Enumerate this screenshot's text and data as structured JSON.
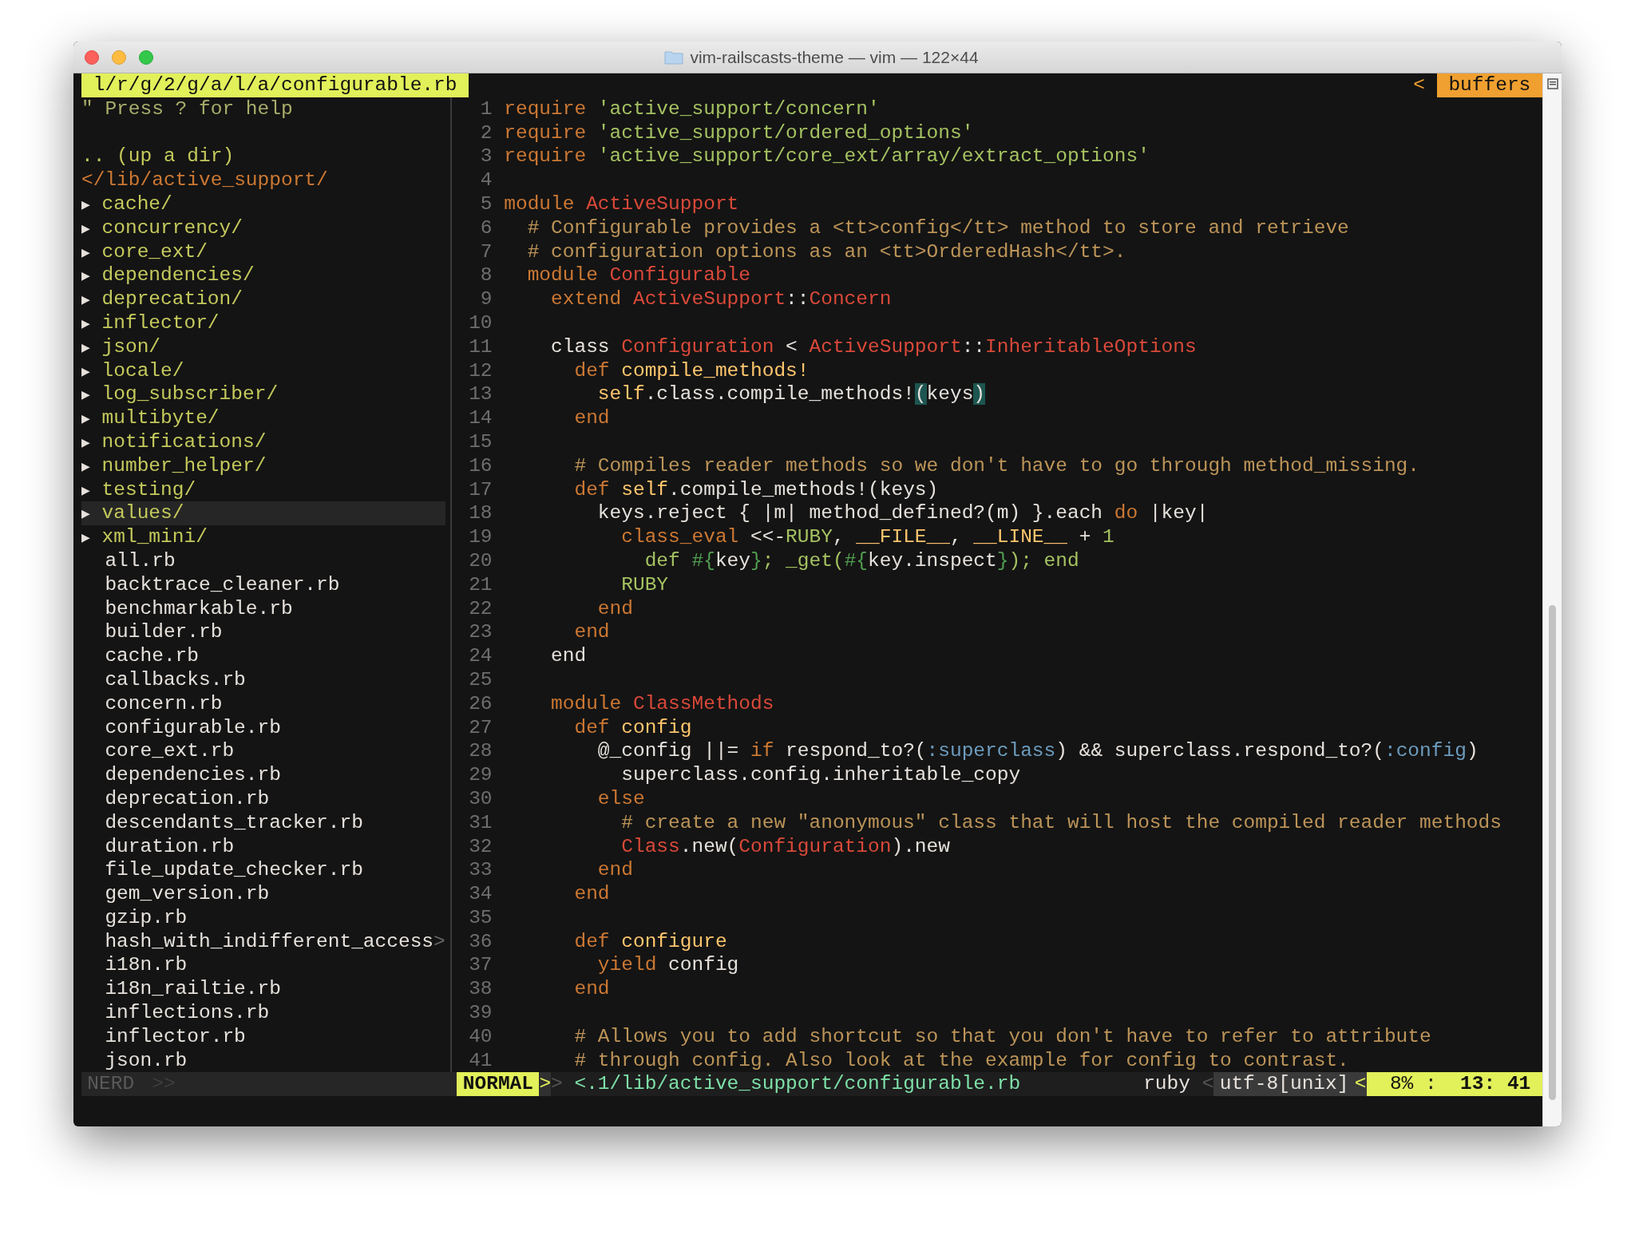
{
  "window": {
    "title": "vim-railscasts-theme — vim — 122×44"
  },
  "tabline": {
    "path": "l/r/g/2/g/a/l/a/configurable.rb",
    "separator": "<",
    "buffers": "buffers"
  },
  "tree": {
    "help": "\" Press ? for help",
    "up_dir": ".. (up a dir)",
    "root": "</lib/active_support/",
    "items": [
      {
        "kind": "dir",
        "arrow": "▶",
        "name": "cache/",
        "selected": false
      },
      {
        "kind": "dir",
        "arrow": "▶",
        "name": "concurrency/",
        "selected": false
      },
      {
        "kind": "dir",
        "arrow": "▶",
        "name": "core_ext/",
        "selected": false
      },
      {
        "kind": "dir",
        "arrow": "▶",
        "name": "dependencies/",
        "selected": false
      },
      {
        "kind": "dir",
        "arrow": "▶",
        "name": "deprecation/",
        "selected": false
      },
      {
        "kind": "dir",
        "arrow": "▶",
        "name": "inflector/",
        "selected": false
      },
      {
        "kind": "dir",
        "arrow": "▶",
        "name": "json/",
        "selected": false
      },
      {
        "kind": "dir",
        "arrow": "▶",
        "name": "locale/",
        "selected": false
      },
      {
        "kind": "dir",
        "arrow": "▶",
        "name": "log_subscriber/",
        "selected": false
      },
      {
        "kind": "dir",
        "arrow": "▶",
        "name": "multibyte/",
        "selected": false
      },
      {
        "kind": "dir",
        "arrow": "▶",
        "name": "notifications/",
        "selected": false
      },
      {
        "kind": "dir",
        "arrow": "▶",
        "name": "number_helper/",
        "selected": false
      },
      {
        "kind": "dir",
        "arrow": "▶",
        "name": "testing/",
        "selected": false
      },
      {
        "kind": "dir",
        "arrow": "▶",
        "name": "values/",
        "selected": true
      },
      {
        "kind": "dir",
        "arrow": "▶",
        "name": "xml_mini/",
        "selected": false
      },
      {
        "kind": "file",
        "name": "all.rb",
        "selected": false
      },
      {
        "kind": "file",
        "name": "backtrace_cleaner.rb",
        "selected": false
      },
      {
        "kind": "file",
        "name": "benchmarkable.rb",
        "selected": false
      },
      {
        "kind": "file",
        "name": "builder.rb",
        "selected": false
      },
      {
        "kind": "file",
        "name": "cache.rb",
        "selected": false
      },
      {
        "kind": "file",
        "name": "callbacks.rb",
        "selected": false
      },
      {
        "kind": "file",
        "name": "concern.rb",
        "selected": false
      },
      {
        "kind": "file",
        "name": "configurable.rb",
        "selected": false
      },
      {
        "kind": "file",
        "name": "core_ext.rb",
        "selected": false
      },
      {
        "kind": "file",
        "name": "dependencies.rb",
        "selected": false
      },
      {
        "kind": "file",
        "name": "deprecation.rb",
        "selected": false
      },
      {
        "kind": "file",
        "name": "descendants_tracker.rb",
        "selected": false
      },
      {
        "kind": "file",
        "name": "duration.rb",
        "selected": false
      },
      {
        "kind": "file",
        "name": "file_update_checker.rb",
        "selected": false
      },
      {
        "kind": "file",
        "name": "gem_version.rb",
        "selected": false
      },
      {
        "kind": "file",
        "name": "gzip.rb",
        "selected": false
      },
      {
        "kind": "file",
        "name": "hash_with_indifferent_access",
        "overflow": ">",
        "selected": false
      },
      {
        "kind": "file",
        "name": "i18n.rb",
        "selected": false
      },
      {
        "kind": "file",
        "name": "i18n_railtie.rb",
        "selected": false
      },
      {
        "kind": "file",
        "name": "inflections.rb",
        "selected": false
      },
      {
        "kind": "file",
        "name": "inflector.rb",
        "selected": false
      },
      {
        "kind": "file",
        "name": "json.rb",
        "selected": false
      }
    ]
  },
  "code": {
    "lines": [
      {
        "number": "1",
        "tokens": [
          {
            "kind": "kw",
            "text": "require "
          },
          {
            "kind": "str",
            "text": "'active_support/concern'"
          }
        ]
      },
      {
        "number": "2",
        "tokens": [
          {
            "kind": "kw",
            "text": "require "
          },
          {
            "kind": "str",
            "text": "'active_support/ordered_options'"
          }
        ]
      },
      {
        "number": "3",
        "tokens": [
          {
            "kind": "kw",
            "text": "require "
          },
          {
            "kind": "str",
            "text": "'active_support/core_ext/array/extract_options'"
          }
        ]
      },
      {
        "number": "4"
      },
      {
        "number": "5",
        "tokens": [
          {
            "kind": "kw",
            "text": "module "
          },
          {
            "kind": "const",
            "text": "ActiveSupport"
          }
        ]
      },
      {
        "number": "6",
        "tokens": [
          {
            "kind": "comment",
            "text": "  # Configurable provides a <tt>config</tt> method to store and retrieve"
          }
        ]
      },
      {
        "number": "7",
        "tokens": [
          {
            "kind": "comment",
            "text": "  # configuration options as an <tt>OrderedHash</tt>."
          }
        ]
      },
      {
        "number": "8",
        "tokens": [
          {
            "kind": "kw",
            "text": "  module "
          },
          {
            "kind": "const",
            "text": "Configurable"
          }
        ]
      },
      {
        "number": "9",
        "tokens": [
          {
            "kind": "kw",
            "text": "    extend "
          },
          {
            "kind": "const",
            "text": "ActiveSupport"
          },
          {
            "kind": "plain",
            "text": "::"
          },
          {
            "kind": "const",
            "text": "Concern"
          }
        ]
      },
      {
        "number": "10"
      },
      {
        "number": "11",
        "tokens": [
          {
            "kind": "plain",
            "text": "    class "
          },
          {
            "kind": "const",
            "text": "Configuration"
          },
          {
            "kind": "plain",
            "text": " < "
          },
          {
            "kind": "const",
            "text": "ActiveSupport"
          },
          {
            "kind": "plain",
            "text": "::"
          },
          {
            "kind": "const",
            "text": "InheritableOptions"
          }
        ]
      },
      {
        "number": "12",
        "tokens": [
          {
            "kind": "kw",
            "text": "      def "
          },
          {
            "kind": "fn",
            "text": "compile_methods!"
          }
        ]
      },
      {
        "number": "13",
        "tokens": [
          {
            "kind": "fn",
            "text": "        self"
          },
          {
            "kind": "plain",
            "text": ".class.compile_methods!"
          },
          {
            "kind": "match",
            "text": "("
          },
          {
            "kind": "plain",
            "text": "keys"
          },
          {
            "kind": "match",
            "text": ")"
          }
        ]
      },
      {
        "number": "14",
        "tokens": [
          {
            "kind": "kw",
            "text": "      end"
          }
        ]
      },
      {
        "number": "15"
      },
      {
        "number": "16",
        "tokens": [
          {
            "kind": "comment",
            "text": "      # Compiles reader methods so we don't have to go through method_missing."
          }
        ]
      },
      {
        "number": "17",
        "tokens": [
          {
            "kind": "kw",
            "text": "      def "
          },
          {
            "kind": "fn",
            "text": "self"
          },
          {
            "kind": "plain",
            "text": ".compile_methods!(keys)"
          }
        ]
      },
      {
        "number": "18",
        "tokens": [
          {
            "kind": "plain",
            "text": "        keys.reject { |m| method_defined?(m) }.each "
          },
          {
            "kind": "kw",
            "text": "do"
          },
          {
            "kind": "plain",
            "text": " |key|"
          }
        ]
      },
      {
        "number": "19",
        "tokens": [
          {
            "kind": "kw",
            "text": "          class_eval"
          },
          {
            "kind": "plain",
            "text": " <<-"
          },
          {
            "kind": "str",
            "text": "RUBY"
          },
          {
            "kind": "plain",
            "text": ", "
          },
          {
            "kind": "fn",
            "text": "__FILE__"
          },
          {
            "kind": "plain",
            "text": ", "
          },
          {
            "kind": "fn",
            "text": "__LINE__"
          },
          {
            "kind": "plain",
            "text": " + "
          },
          {
            "kind": "str",
            "text": "1"
          }
        ]
      },
      {
        "number": "20",
        "tokens": [
          {
            "kind": "str",
            "text": "            def "
          },
          {
            "kind": "interp",
            "text": "#{"
          },
          {
            "kind": "plain",
            "text": "key"
          },
          {
            "kind": "interp",
            "text": "}"
          },
          {
            "kind": "str",
            "text": "; _get("
          },
          {
            "kind": "interp",
            "text": "#{"
          },
          {
            "kind": "plain",
            "text": "key.inspect"
          },
          {
            "kind": "interp",
            "text": "}"
          },
          {
            "kind": "str",
            "text": "); end"
          }
        ]
      },
      {
        "number": "21",
        "tokens": [
          {
            "kind": "str",
            "text": "          RUBY"
          }
        ]
      },
      {
        "number": "22",
        "tokens": [
          {
            "kind": "kw",
            "text": "        end"
          }
        ]
      },
      {
        "number": "23",
        "tokens": [
          {
            "kind": "kw",
            "text": "      end"
          }
        ]
      },
      {
        "number": "24",
        "tokens": [
          {
            "kind": "plain",
            "text": "    end"
          }
        ]
      },
      {
        "number": "25"
      },
      {
        "number": "26",
        "tokens": [
          {
            "kind": "kw",
            "text": "    module "
          },
          {
            "kind": "const",
            "text": "ClassMethods"
          }
        ]
      },
      {
        "number": "27",
        "tokens": [
          {
            "kind": "kw",
            "text": "      def "
          },
          {
            "kind": "fn",
            "text": "config"
          }
        ]
      },
      {
        "number": "28",
        "tokens": [
          {
            "kind": "plain",
            "text": "        @_config ||= "
          },
          {
            "kind": "kw",
            "text": "if"
          },
          {
            "kind": "plain",
            "text": " respond_to?("
          },
          {
            "kind": "sym",
            "text": ":superclass"
          },
          {
            "kind": "plain",
            "text": ") && superclass.respond_to?("
          },
          {
            "kind": "sym",
            "text": ":config"
          },
          {
            "kind": "plain",
            "text": ")"
          }
        ]
      },
      {
        "number": "29",
        "tokens": [
          {
            "kind": "plain",
            "text": "          superclass.config.inheritable_copy"
          }
        ]
      },
      {
        "number": "30",
        "tokens": [
          {
            "kind": "kw",
            "text": "        else"
          }
        ]
      },
      {
        "number": "31",
        "tokens": [
          {
            "kind": "comment",
            "text": "          # create a new \"anonymous\" class that will host the compiled reader methods"
          }
        ]
      },
      {
        "number": "32",
        "tokens": [
          {
            "kind": "const",
            "text": "          Class"
          },
          {
            "kind": "plain",
            "text": ".new("
          },
          {
            "kind": "const",
            "text": "Configuration"
          },
          {
            "kind": "plain",
            "text": ").new"
          }
        ]
      },
      {
        "number": "33",
        "tokens": [
          {
            "kind": "kw",
            "text": "        end"
          }
        ]
      },
      {
        "number": "34",
        "tokens": [
          {
            "kind": "kw",
            "text": "      end"
          }
        ]
      },
      {
        "number": "35"
      },
      {
        "number": "36",
        "tokens": [
          {
            "kind": "kw",
            "text": "      def "
          },
          {
            "kind": "fn",
            "text": "configure"
          }
        ]
      },
      {
        "number": "37",
        "tokens": [
          {
            "kind": "kw",
            "text": "        yield"
          },
          {
            "kind": "plain",
            "text": " config"
          }
        ]
      },
      {
        "number": "38",
        "tokens": [
          {
            "kind": "kw",
            "text": "      end"
          }
        ]
      },
      {
        "number": "39"
      },
      {
        "number": "40",
        "tokens": [
          {
            "kind": "comment",
            "text": "      # Allows you to add shortcut so that you don't have to refer to attribute"
          }
        ]
      },
      {
        "number": "41",
        "tokens": [
          {
            "kind": "comment",
            "text": "      # through config. Also look at the example for config to contrast."
          }
        ]
      }
    ]
  },
  "status": {
    "tree_label": "NERD",
    "tree_separator": ">>",
    "mode": "NORMAL",
    "mode_separator": ">",
    "separator": ">",
    "file": "<.1/lib/active_support/configurable.rb",
    "filetype": "ruby",
    "encoding_separator": "<",
    "encoding": "utf-8[unix]",
    "position_separator": "<",
    "percent": "8% :",
    "position": "13: 41"
  }
}
